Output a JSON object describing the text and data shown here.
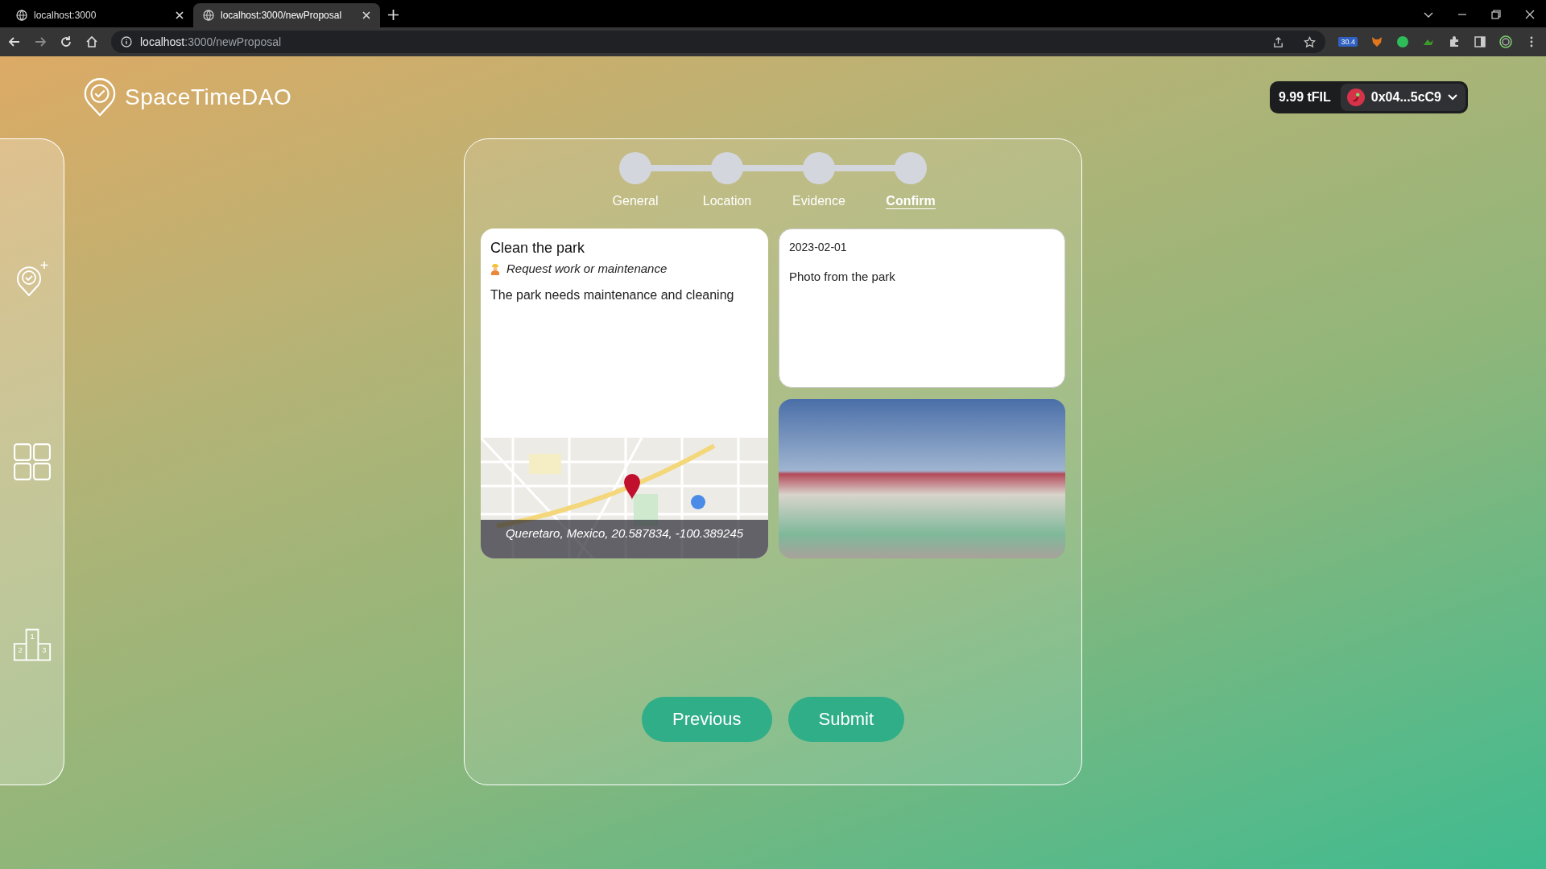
{
  "browser": {
    "tabs": [
      {
        "title": "localhost:3000",
        "selected": false
      },
      {
        "title": "localhost:3000/newProposal",
        "selected": true
      }
    ],
    "url_host": "localhost",
    "url_rest": ":3000/newProposal",
    "extension_badge": "30.4"
  },
  "brand": "SpaceTimeDAO",
  "wallet": {
    "balance": "9.99 tFIL",
    "address": "0x04...5cC9"
  },
  "sidebar": {
    "items": [
      {
        "kind": "add-location"
      },
      {
        "kind": "grid"
      },
      {
        "kind": "podium",
        "ranks": [
          "1",
          "2",
          "3"
        ]
      }
    ]
  },
  "steps": [
    {
      "label": "General",
      "selected": false
    },
    {
      "label": "Location",
      "selected": false
    },
    {
      "label": "Evidence",
      "selected": false
    },
    {
      "label": "Confirm",
      "selected": true
    }
  ],
  "proposal": {
    "title": "Clean the park",
    "category": "Request work or maintenance",
    "description": "The park needs maintenance and cleaning",
    "location": "Queretaro, Mexico, 20.587834, -100.389245"
  },
  "evidence": {
    "date": "2023-02-01",
    "description": "Photo from the park"
  },
  "buttons": [
    {
      "label": "Previous"
    },
    {
      "label": "Submit"
    }
  ]
}
